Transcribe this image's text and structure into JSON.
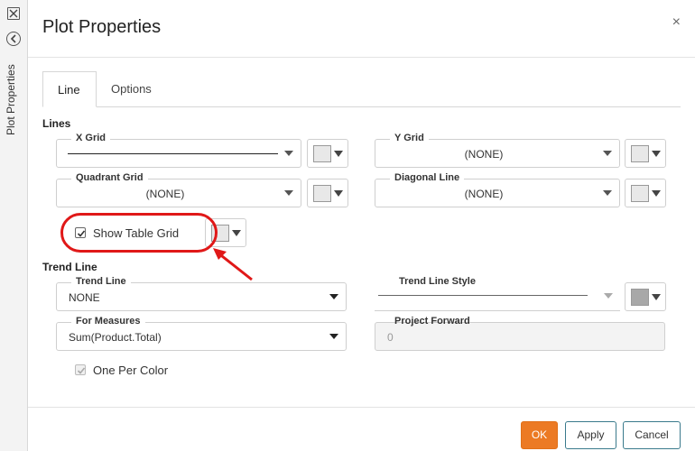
{
  "rail": {
    "label": "Plot Properties",
    "close_icon": "close-icon",
    "back_icon": "back-circle-icon"
  },
  "dialog": {
    "title": "Plot Properties",
    "close_glyph": "×"
  },
  "tabs": [
    {
      "label": "Line",
      "active": true
    },
    {
      "label": "Options",
      "active": false
    }
  ],
  "lines": {
    "heading": "Lines",
    "x_grid": {
      "label": "X Grid",
      "value": ""
    },
    "y_grid": {
      "label": "Y Grid",
      "value": "(NONE)"
    },
    "quadrant_grid": {
      "label": "Quadrant Grid",
      "value": "(NONE)"
    },
    "diagonal_line": {
      "label": "Diagonal Line",
      "value": "(NONE)"
    },
    "show_table_grid": {
      "label": "Show Table Grid",
      "checked": true
    }
  },
  "trend": {
    "heading": "Trend Line",
    "trend_line": {
      "label": "Trend Line",
      "value": "NONE"
    },
    "trend_line_style": {
      "label": "Trend Line Style",
      "value": ""
    },
    "for_measures": {
      "label": "For Measures",
      "value": "Sum(Product.Total)"
    },
    "project_forward": {
      "label": "Project Forward",
      "value": "0"
    },
    "one_per_color": {
      "label": "One Per Color",
      "checked": true,
      "disabled": true
    }
  },
  "footer": {
    "ok": "OK",
    "apply": "Apply",
    "cancel": "Cancel"
  },
  "colors": {
    "primary_button": "#ec7a24",
    "annotation": "#e01818"
  }
}
